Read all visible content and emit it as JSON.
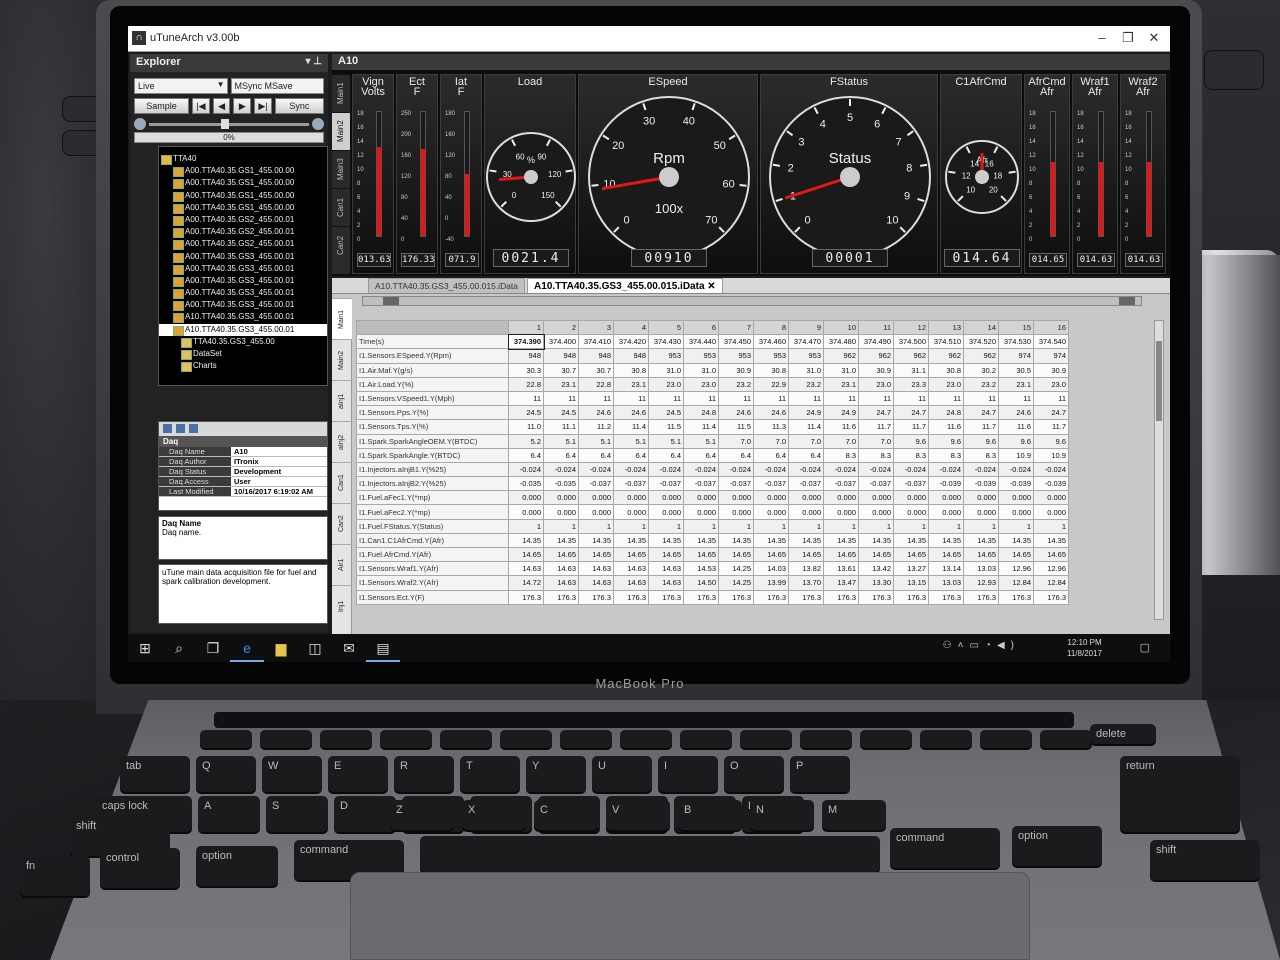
{
  "window": {
    "title": "uTuneArch v3.00b"
  },
  "explorer": {
    "title": "Explorer",
    "mode": "Live",
    "sync_mode": "MSync MSave",
    "sample_label": "Sample",
    "sync_label": "Sync",
    "progress": "0%",
    "tree_root": "TTA40",
    "tree_items": [
      "A00.TTA40.35.GS1_455.00.00",
      "A00.TTA40.35.GS1_455.00.00",
      "A00.TTA40.35.GS1_455.00.00",
      "A00.TTA40.35.GS1_455.00.00",
      "A00.TTA40.35.GS2_455.00.01",
      "A00.TTA40.35.GS2_455.00.01",
      "A00.TTA40.35.GS2_455.00.01",
      "A00.TTA40.35.GS3_455.00.01",
      "A00.TTA40.35.GS3_455.00.01",
      "A00.TTA40.35.GS3_455.00.01",
      "A00.TTA40.35.GS3_455.00.01",
      "A00.TTA40.35.GS3_455.00.01",
      "A10.TTA40.35.GS3_455.00.01"
    ],
    "tree_selected": "A10.TTA40.35.GS3_455.00.01",
    "tree_sub": [
      "TTA40.35.GS3_455.00",
      "DataSet",
      "Charts"
    ]
  },
  "properties": {
    "category": "Daq",
    "rows": [
      {
        "k": "Daq Name",
        "v": "A10"
      },
      {
        "k": "Daq Author",
        "v": "ITronix"
      },
      {
        "k": "Daq Status",
        "v": "Development"
      },
      {
        "k": "Daq Access",
        "v": "User"
      },
      {
        "k": "Last Modified",
        "v": "10/16/2017 6:19:02 AM"
      }
    ],
    "desc_title": "Daq Name",
    "desc_text": "Daq name.",
    "note": "uTune main data acquisition file for fuel and spark calibration development."
  },
  "dashboard": {
    "title": "A10",
    "tabs": [
      "Main1",
      "Main2",
      "Main3",
      "Can1",
      "Can2"
    ],
    "active_tab": "Main2",
    "bars": [
      {
        "title": "Vign",
        "subtitle": "Volts",
        "ticks": [
          "18",
          "16",
          "14",
          "12",
          "10",
          "8",
          "6",
          "4",
          "2",
          "0"
        ],
        "fraction": 0.72,
        "readout": "013.63"
      },
      {
        "title": "Ect",
        "subtitle": "F",
        "ticks": [
          "250",
          "200",
          "160",
          "120",
          "80",
          "40",
          "0"
        ],
        "fraction": 0.7,
        "readout": "176.33"
      },
      {
        "title": "Iat",
        "subtitle": "F",
        "ticks": [
          "180",
          "160",
          "120",
          "80",
          "40",
          "0",
          "-40"
        ],
        "fraction": 0.5,
        "readout": "071.9"
      }
    ],
    "gauges": [
      {
        "title": "Load",
        "center": "%",
        "ticks": [
          "0",
          "30",
          "60",
          "90",
          "120",
          "150"
        ],
        "readout": "0021.4"
      },
      {
        "title": "ESpeed",
        "center": "Rpm",
        "sub": "100x",
        "ticks": [
          "0",
          "10",
          "20",
          "30",
          "40",
          "50",
          "60",
          "70"
        ],
        "readout": "00910"
      },
      {
        "title": "FStatus",
        "center": "Status",
        "ticks": [
          "0",
          "1",
          "2",
          "3",
          "4",
          "5",
          "6",
          "7",
          "8",
          "9",
          "10"
        ],
        "readout": "00001"
      },
      {
        "title": "C1AfrCmd",
        "center": "Afr",
        "ticks": [
          "10",
          "12",
          "14",
          "16",
          "18",
          "20"
        ],
        "readout": "014.64"
      }
    ],
    "afr_bars": [
      {
        "title": "AfrCmd",
        "subtitle": "Afr",
        "ticks": [
          "18",
          "16",
          "14",
          "12",
          "10",
          "8",
          "6",
          "4",
          "2",
          "0"
        ],
        "fraction": 0.6,
        "readout": "014.65"
      },
      {
        "title": "Wraf1",
        "subtitle": "Afr",
        "ticks": [
          "18",
          "16",
          "14",
          "12",
          "10",
          "8",
          "6",
          "4",
          "2",
          "0"
        ],
        "fraction": 0.6,
        "readout": "014.63"
      },
      {
        "title": "Wraf2",
        "subtitle": "Afr",
        "ticks": [
          "18",
          "16",
          "14",
          "12",
          "10",
          "8",
          "6",
          "4",
          "2",
          "0"
        ],
        "fraction": 0.6,
        "readout": "014.63"
      }
    ]
  },
  "datagrid": {
    "tabs": [
      "A10.TTA40.35.GS3_455.00.015.iData",
      "A10.TTA40.35.GS3_455.00.015.iData"
    ],
    "side_tabs": [
      "Main1",
      "Main2",
      "aInj1",
      "aInj2",
      "Can1",
      "Can2",
      "Air1",
      "Inj1"
    ],
    "columns": [
      "1",
      "2",
      "3",
      "4",
      "5",
      "6",
      "7",
      "8",
      "9",
      "10",
      "11",
      "12",
      "13",
      "14",
      "15",
      "16"
    ],
    "rows": [
      {
        "label": "Time(s)",
        "values": [
          "374.390",
          "374.400",
          "374.410",
          "374.420",
          "374.430",
          "374.440",
          "374.450",
          "374.460",
          "374.470",
          "374.480",
          "374.490",
          "374.500",
          "374.510",
          "374.520",
          "374.530",
          "374.540"
        ]
      },
      {
        "label": "I1.Sensors.ESpeed.Y(Rpm)",
        "values": [
          "948",
          "948",
          "948",
          "948",
          "953",
          "953",
          "953",
          "953",
          "953",
          "962",
          "962",
          "962",
          "962",
          "962",
          "974",
          "974"
        ]
      },
      {
        "label": "I1.Air.Maf.Y(g/s)",
        "values": [
          "30.3",
          "30.7",
          "30.7",
          "30.8",
          "31.0",
          "31.0",
          "30.9",
          "30.8",
          "31.0",
          "31.0",
          "30.9",
          "31.1",
          "30.8",
          "30.2",
          "30.5",
          "30.9"
        ]
      },
      {
        "label": "I1.Air.Load.Y(%)",
        "values": [
          "22.8",
          "23.1",
          "22.8",
          "23.1",
          "23.0",
          "23.0",
          "23.2",
          "22.9",
          "23.2",
          "23.1",
          "23.0",
          "23.3",
          "23.0",
          "23.2",
          "23.1",
          "23.0"
        ]
      },
      {
        "label": "I1.Sensors.VSpeed1.Y(Mph)",
        "values": [
          "11",
          "11",
          "11",
          "11",
          "11",
          "11",
          "11",
          "11",
          "11",
          "11",
          "11",
          "11",
          "11",
          "11",
          "11",
          "11"
        ]
      },
      {
        "label": "I1.Sensors.Pps.Y(%)",
        "values": [
          "24.5",
          "24.5",
          "24.6",
          "24.6",
          "24.5",
          "24.8",
          "24.6",
          "24.6",
          "24.9",
          "24.9",
          "24.7",
          "24.7",
          "24.8",
          "24.7",
          "24.6",
          "24.7"
        ]
      },
      {
        "label": "I1.Sensors.Tps.Y(%)",
        "values": [
          "11.0",
          "11.1",
          "11.2",
          "11.4",
          "11.5",
          "11.4",
          "11.5",
          "11.3",
          "11.4",
          "11.6",
          "11.7",
          "11.7",
          "11.6",
          "11.7",
          "11.6",
          "11.7"
        ]
      },
      {
        "label": "I1.Spark.SparkAngleOEM.Y(BTDC)",
        "values": [
          "5.2",
          "5.1",
          "5.1",
          "5.1",
          "5.1",
          "5.1",
          "7.0",
          "7.0",
          "7.0",
          "7.0",
          "7.0",
          "9.6",
          "9.6",
          "9.6",
          "9.6",
          "9.6"
        ]
      },
      {
        "label": "I1.Spark.SparkAngle.Y(BTDC)",
        "values": [
          "6.4",
          "6.4",
          "6.4",
          "6.4",
          "6.4",
          "6.4",
          "6.4",
          "6.4",
          "6.4",
          "8.3",
          "8.3",
          "8.3",
          "8.3",
          "8.3",
          "10.9",
          "10.9"
        ]
      },
      {
        "label": "I1.Injectors.aInjB1.Y(%25)",
        "values": [
          "-0.024",
          "-0.024",
          "-0.024",
          "-0.024",
          "-0.024",
          "-0.024",
          "-0.024",
          "-0.024",
          "-0.024",
          "-0.024",
          "-0.024",
          "-0.024",
          "-0.024",
          "-0.024",
          "-0.024",
          "-0.024"
        ]
      },
      {
        "label": "I1.Injectors.aInjB2.Y(%25)",
        "values": [
          "-0.035",
          "-0.035",
          "-0.037",
          "-0.037",
          "-0.037",
          "-0.037",
          "-0.037",
          "-0.037",
          "-0.037",
          "-0.037",
          "-0.037",
          "-0.037",
          "-0.039",
          "-0.039",
          "-0.039",
          "-0.039"
        ]
      },
      {
        "label": "I1.Fuel.aFec1.Y(*mp)",
        "values": [
          "0.000",
          "0.000",
          "0.000",
          "0.000",
          "0.000",
          "0.000",
          "0.000",
          "0.000",
          "0.000",
          "0.000",
          "0.000",
          "0.000",
          "0.000",
          "0.000",
          "0.000",
          "0.000"
        ]
      },
      {
        "label": "I1.Fuel.aFec2.Y(*mp)",
        "values": [
          "0.000",
          "0.000",
          "0.000",
          "0.000",
          "0.000",
          "0.000",
          "0.000",
          "0.000",
          "0.000",
          "0.000",
          "0.000",
          "0.000",
          "0.000",
          "0.000",
          "0.000",
          "0.000"
        ]
      },
      {
        "label": "I1.Fuel.FStatus.Y(Status)",
        "values": [
          "1",
          "1",
          "1",
          "1",
          "1",
          "1",
          "1",
          "1",
          "1",
          "1",
          "1",
          "1",
          "1",
          "1",
          "1",
          "1"
        ]
      },
      {
        "label": "I1.Can1.C1AfrCmd.Y(Afr)",
        "values": [
          "14.35",
          "14.35",
          "14.35",
          "14.35",
          "14.35",
          "14.35",
          "14.35",
          "14.35",
          "14.35",
          "14.35",
          "14.35",
          "14.35",
          "14.35",
          "14.35",
          "14.35",
          "14.35"
        ]
      },
      {
        "label": "I1.Fuel.AfrCmd.Y(Afr)",
        "values": [
          "14.65",
          "14.65",
          "14.65",
          "14.65",
          "14.65",
          "14.65",
          "14.65",
          "14.65",
          "14.65",
          "14.65",
          "14.65",
          "14.65",
          "14.65",
          "14.65",
          "14.65",
          "14.65"
        ]
      },
      {
        "label": "I1.Sensors.Wraf1.Y(Afr)",
        "values": [
          "14.63",
          "14.63",
          "14.63",
          "14.63",
          "14.63",
          "14.53",
          "14.25",
          "14.03",
          "13.82",
          "13.61",
          "13.42",
          "13.27",
          "13.14",
          "13.03",
          "12.96",
          "12.96"
        ]
      },
      {
        "label": "I1.Sensors.Wraf2.Y(Afr)",
        "values": [
          "14.72",
          "14.63",
          "14.63",
          "14.63",
          "14.63",
          "14.50",
          "14.25",
          "13.99",
          "13.70",
          "13.47",
          "13.30",
          "13.15",
          "13.03",
          "12.93",
          "12.84",
          "12.84"
        ]
      },
      {
        "label": "I1.Sensors.Ect.Y(F)",
        "values": [
          "176.3",
          "176.3",
          "176.3",
          "176.3",
          "176.3",
          "176.3",
          "176.3",
          "176.3",
          "176.3",
          "176.3",
          "176.3",
          "176.3",
          "176.3",
          "176.3",
          "176.3",
          "176.3"
        ]
      }
    ]
  },
  "taskbar": {
    "time": "12:10 PM",
    "date": "11/8/2017"
  },
  "laptop": {
    "brand": "MacBook Pro"
  },
  "keyboard": {
    "row1": [
      "tab",
      "Q",
      "W",
      "E",
      "R",
      "T",
      "Y",
      "U",
      "I",
      "O",
      "P"
    ],
    "row2": [
      "caps lock",
      "A",
      "S",
      "D",
      "F",
      "G",
      "H",
      "J",
      "K",
      "L"
    ],
    "row3": [
      "shift",
      "Z",
      "X",
      "C",
      "V",
      "B",
      "N",
      "M"
    ],
    "row4": [
      "fn",
      "control",
      "option",
      "command",
      "command",
      "option"
    ],
    "right_keys": [
      "delete",
      "return",
      "shift"
    ]
  },
  "colors": {
    "needle": "#e01818",
    "bar_fill": "#e11111",
    "selection": "#ffffff"
  }
}
